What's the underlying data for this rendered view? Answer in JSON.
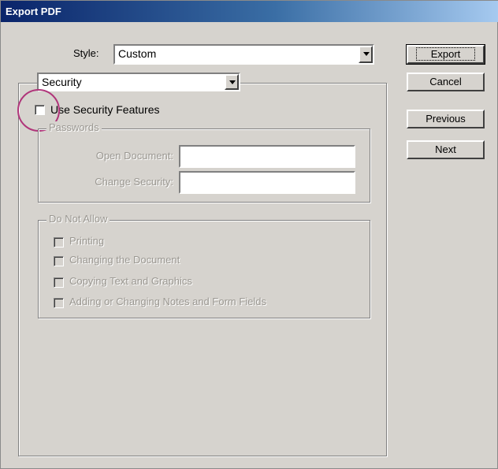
{
  "window": {
    "title": "Export PDF"
  },
  "style_row": {
    "label": "Style:",
    "value": "Custom"
  },
  "section_select": {
    "value": "Security"
  },
  "buttons": {
    "export": "Export",
    "cancel": "Cancel",
    "previous": "Previous",
    "next": "Next"
  },
  "use_security": {
    "label": "Use Security Features",
    "checked": false
  },
  "passwords": {
    "legend": "Passwords",
    "open_label": "Open Document:",
    "open_value": "",
    "change_label": "Change Security:",
    "change_value": ""
  },
  "do_not_allow": {
    "legend": "Do Not Allow",
    "items": [
      {
        "label": "Printing",
        "checked": false
      },
      {
        "label": "Changing the Document",
        "checked": false
      },
      {
        "label": "Copying Text and Graphics",
        "checked": false
      },
      {
        "label": "Adding or Changing Notes and Form Fields",
        "checked": false
      }
    ]
  },
  "colors": {
    "dialog_bg": "#d6d3ce",
    "title_start": "#0a246a",
    "title_end": "#a6caf0",
    "highlight": "#b0357a"
  }
}
